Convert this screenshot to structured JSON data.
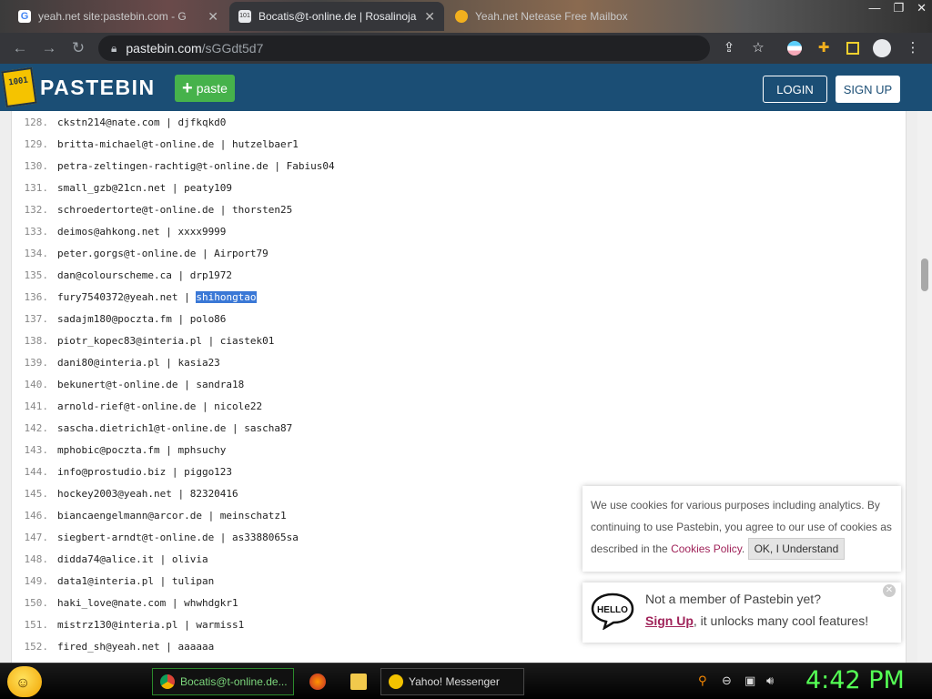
{
  "browser": {
    "tabs": [
      {
        "title": "yeah.net site:pastebin.com - G",
        "active": false
      },
      {
        "title": "Bocatis@t-online.de | Rosalinojan",
        "active": true
      },
      {
        "title": "Yeah.net Netease Free Mailbox",
        "active": false
      }
    ],
    "url_host": "pastebin.com",
    "url_path": "/sGGdt5d7"
  },
  "header": {
    "logo_text": "PASTEBIN",
    "logo_mark": "1001",
    "paste_label": "paste",
    "login_label": "LOGIN",
    "signup_label": "SIGN UP"
  },
  "lines": [
    {
      "n": "128.",
      "text": "ckstn214@nate.com | djfkqkd0"
    },
    {
      "n": "129.",
      "text": "britta-michael@t-online.de | hutzelbaer1"
    },
    {
      "n": "130.",
      "text": "petra-zeltingen-rachtig@t-online.de | Fabius04"
    },
    {
      "n": "131.",
      "text": "small_gzb@21cn.net | peaty109"
    },
    {
      "n": "132.",
      "text": "schroedertorte@t-online.de | thorsten25"
    },
    {
      "n": "133.",
      "text": "deimos@ahkong.net | xxxx9999"
    },
    {
      "n": "134.",
      "text": "peter.gorgs@t-online.de | Airport79"
    },
    {
      "n": "135.",
      "text": "dan@colourscheme.ca | drp1972"
    },
    {
      "n": "136.",
      "text": "fury7540372@yeah.net | ",
      "sel": "shihongtao"
    },
    {
      "n": "137.",
      "text": "sadajm180@poczta.fm | polo86"
    },
    {
      "n": "138.",
      "text": "piotr_kopec83@interia.pl | ciastek01"
    },
    {
      "n": "139.",
      "text": "dani80@interia.pl | kasia23"
    },
    {
      "n": "140.",
      "text": "bekunert@t-online.de | sandra18"
    },
    {
      "n": "141.",
      "text": "arnold-rief@t-online.de | nicole22"
    },
    {
      "n": "142.",
      "text": "sascha.dietrich1@t-online.de | sascha87"
    },
    {
      "n": "143.",
      "text": "mphobic@poczta.fm | mphsuchy"
    },
    {
      "n": "144.",
      "text": "info@prostudio.biz | piggo123"
    },
    {
      "n": "145.",
      "text": "hockey2003@yeah.net | 82320416"
    },
    {
      "n": "146.",
      "text": "biancaengelmann@arcor.de | meinschatz1"
    },
    {
      "n": "147.",
      "text": "siegbert-arndt@t-online.de | as3388065sa"
    },
    {
      "n": "148.",
      "text": "didda74@alice.it | olivia"
    },
    {
      "n": "149.",
      "text": "data1@interia.pl | tulipan"
    },
    {
      "n": "150.",
      "text": "haki_love@nate.com | whwhdgkr1"
    },
    {
      "n": "151.",
      "text": "mistrz130@interia.pl | warmiss1"
    },
    {
      "n": "152.",
      "text": "fired_sh@yeah.net | aaaaaa"
    }
  ],
  "cookie": {
    "text_1": "We use cookies for various purposes including analytics. By",
    "text_2": "continuing to use Pastebin, you agree to our use of cookies as",
    "text_3_pre": "described in the ",
    "policy_link": "Cookies Policy",
    "text_3_post": ".",
    "ok_label": "OK, I Understand"
  },
  "member": {
    "icon_text": "HELLO",
    "question": "Not a member of Pastebin yet?",
    "signup_link": "Sign Up",
    "rest": ", it unlocks many cool features!"
  },
  "taskbar": {
    "task1_label": "Bocatis@t-online.de...",
    "task2_label": "Yahoo! Messenger",
    "clock": "4:42 PM"
  },
  "colors": {
    "pastebin_header": "#1b4e75",
    "paste_button": "#46b24b",
    "selection": "#3a78d6",
    "link": "#a0245a",
    "clock": "#55ff55"
  }
}
